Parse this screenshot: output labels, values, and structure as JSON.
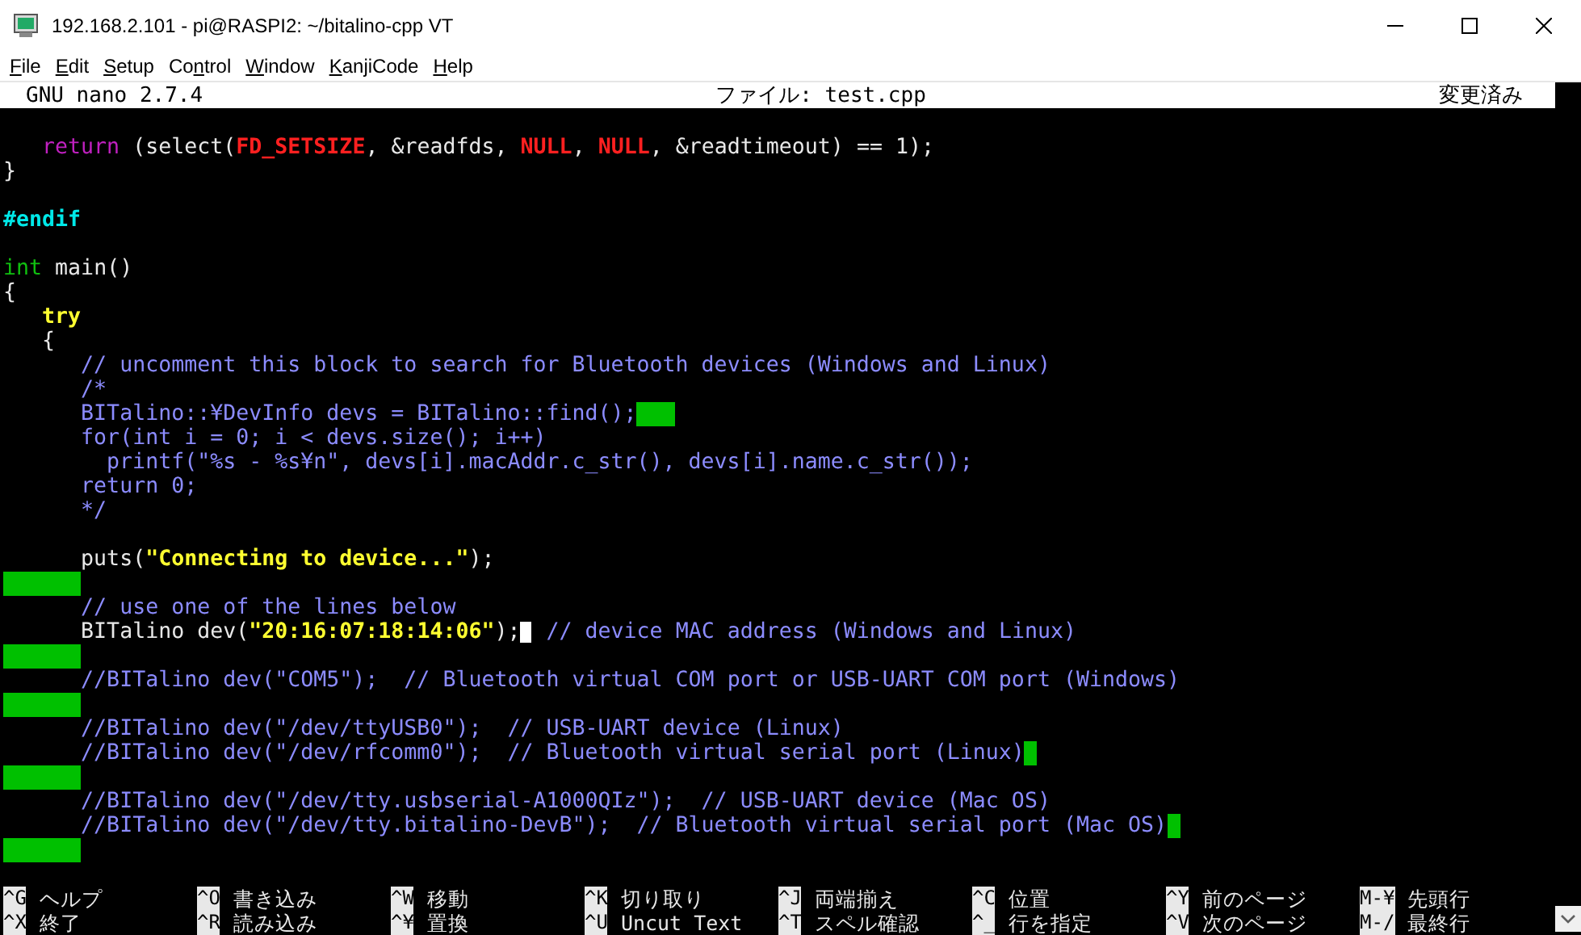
{
  "window": {
    "title": "192.168.2.101 - pi@RASPI2: ~/bitalino-cpp VT"
  },
  "menu": [
    {
      "access_key": "F",
      "rest": "ile"
    },
    {
      "access_key": "E",
      "rest": "dit"
    },
    {
      "access_key": "S",
      "rest": "etup"
    },
    {
      "lead": "Co",
      "access_key": "n",
      "rest": "trol"
    },
    {
      "access_key": "W",
      "rest": "indow"
    },
    {
      "access_key": "K",
      "rest": "anjiCode"
    },
    {
      "access_key": "H",
      "rest": "elp"
    }
  ],
  "header": {
    "version": "GNU nano 2.7.4",
    "file": "ファイル: test.cpp",
    "status": "変更済み"
  },
  "lines": [
    {
      "kind": "blank"
    },
    {
      "kind": "code",
      "segments": [
        {
          "kind": "keyword",
          "text": "   return"
        },
        {
          "kind": "plain",
          "text": " (select("
        },
        {
          "kind": "macro",
          "text": "FD_SETSIZE"
        },
        {
          "kind": "plain",
          "text": ", &readfds, "
        },
        {
          "kind": "macro",
          "text": "NULL"
        },
        {
          "kind": "plain",
          "text": ", "
        },
        {
          "kind": "macro",
          "text": "NULL"
        },
        {
          "kind": "plain",
          "text": ", &readtimeout) == 1);"
        }
      ]
    },
    {
      "kind": "code",
      "segments": [
        {
          "kind": "plain",
          "text": "}"
        }
      ]
    },
    {
      "kind": "blank"
    },
    {
      "kind": "code",
      "segments": [
        {
          "kind": "preproc",
          "text": "#endif"
        }
      ]
    },
    {
      "kind": "blank"
    },
    {
      "kind": "code",
      "segments": [
        {
          "kind": "type",
          "text": "int"
        },
        {
          "kind": "plain",
          "text": " main()"
        }
      ]
    },
    {
      "kind": "code",
      "segments": [
        {
          "kind": "plain",
          "text": "{"
        }
      ]
    },
    {
      "kind": "code",
      "segments": [
        {
          "kind": "control",
          "text": "   try"
        }
      ]
    },
    {
      "kind": "code",
      "segments": [
        {
          "kind": "plain",
          "text": "   {"
        }
      ]
    },
    {
      "kind": "code",
      "segments": [
        {
          "kind": "comment",
          "text": "      // uncomment this block to search for Bluetooth devices (Windows and Linux)"
        }
      ]
    },
    {
      "kind": "code",
      "segments": [
        {
          "kind": "comment",
          "text": "      /*"
        }
      ]
    },
    {
      "kind": "code",
      "segments": [
        {
          "kind": "comment",
          "text": "      BITalino::¥DevInfo devs = BITalino::find();"
        },
        {
          "kind": "trailmedium"
        }
      ]
    },
    {
      "kind": "code",
      "segments": [
        {
          "kind": "comment",
          "text": "      for(int i = 0; i < devs.size(); i++)"
        }
      ]
    },
    {
      "kind": "code",
      "segments": [
        {
          "kind": "comment",
          "text": "        printf(\"%s - %s¥n\", devs[i].macAddr.c_str(), devs[i].name.c_str());"
        }
      ]
    },
    {
      "kind": "code",
      "segments": [
        {
          "kind": "comment",
          "text": "      return 0;"
        }
      ]
    },
    {
      "kind": "code",
      "segments": [
        {
          "kind": "comment",
          "text": "      */"
        }
      ]
    },
    {
      "kind": "blank"
    },
    {
      "kind": "code",
      "segments": [
        {
          "kind": "plain",
          "text": "      puts("
        },
        {
          "kind": "string",
          "text": "\"Connecting to device...\""
        },
        {
          "kind": "plain",
          "text": ");"
        }
      ]
    },
    {
      "kind": "code",
      "segments": [
        {
          "kind": "trailwide"
        }
      ]
    },
    {
      "kind": "code",
      "segments": [
        {
          "kind": "comment",
          "text": "      // use one of the lines below"
        }
      ]
    },
    {
      "kind": "code",
      "segments": [
        {
          "kind": "plain",
          "text": "      BITalino dev("
        },
        {
          "kind": "string",
          "text": "\"20:16:07:18:14:06\""
        },
        {
          "kind": "plain",
          "text": ");"
        },
        {
          "kind": "cursor"
        },
        {
          "kind": "comment",
          "text": " // device MAC address (Windows and Linux)"
        }
      ]
    },
    {
      "kind": "code",
      "segments": [
        {
          "kind": "trailwide"
        }
      ]
    },
    {
      "kind": "code",
      "segments": [
        {
          "kind": "comment",
          "text": "      //BITalino dev(\"COM5\");  // Bluetooth virtual COM port or USB-UART COM port (Windows)"
        }
      ]
    },
    {
      "kind": "code",
      "segments": [
        {
          "kind": "trailwide"
        }
      ]
    },
    {
      "kind": "code",
      "segments": [
        {
          "kind": "comment",
          "text": "      //BITalino dev(\"/dev/ttyUSB0\");  // USB-UART device (Linux)"
        }
      ]
    },
    {
      "kind": "code",
      "segments": [
        {
          "kind": "comment",
          "text": "      //BITalino dev(\"/dev/rfcomm0\");  // Bluetooth virtual serial port (Linux)"
        },
        {
          "kind": "trailnarrow"
        }
      ]
    },
    {
      "kind": "code",
      "segments": [
        {
          "kind": "trailwide"
        }
      ]
    },
    {
      "kind": "code",
      "segments": [
        {
          "kind": "comment",
          "text": "      //BITalino dev(\"/dev/tty.usbserial-A1000QIz\");  // USB-UART device (Mac OS)"
        }
      ]
    },
    {
      "kind": "code",
      "segments": [
        {
          "kind": "comment",
          "text": "      //BITalino dev(\"/dev/tty.bitalino-DevB\");  // Bluetooth virtual serial port (Mac OS)"
        },
        {
          "kind": "trailnarrow"
        }
      ]
    },
    {
      "kind": "code",
      "segments": [
        {
          "kind": "trailwide"
        }
      ]
    }
  ],
  "shortcuts": [
    [
      {
        "key": "^G",
        "label": "ヘルプ"
      },
      {
        "key": "^O",
        "label": "書き込み"
      },
      {
        "key": "^W",
        "label": "移動"
      },
      {
        "key": "^K",
        "label": "切り取り"
      },
      {
        "key": "^J",
        "label": "両端揃え"
      },
      {
        "key": "^C",
        "label": "位置"
      },
      {
        "key": "^Y",
        "label": "前のページ"
      },
      {
        "key": "M-¥",
        "label": "先頭行"
      }
    ],
    [
      {
        "key": "^X",
        "label": "終了"
      },
      {
        "key": "^R",
        "label": "読み込み"
      },
      {
        "key": "^¥",
        "label": "置換"
      },
      {
        "key": "^U",
        "label": "Uncut Text"
      },
      {
        "key": "^T",
        "label": "スペル確認"
      },
      {
        "key": "^_",
        "label": "行を指定"
      },
      {
        "key": "^V",
        "label": "次のページ"
      },
      {
        "key": "M-/",
        "label": "最終行"
      }
    ]
  ]
}
